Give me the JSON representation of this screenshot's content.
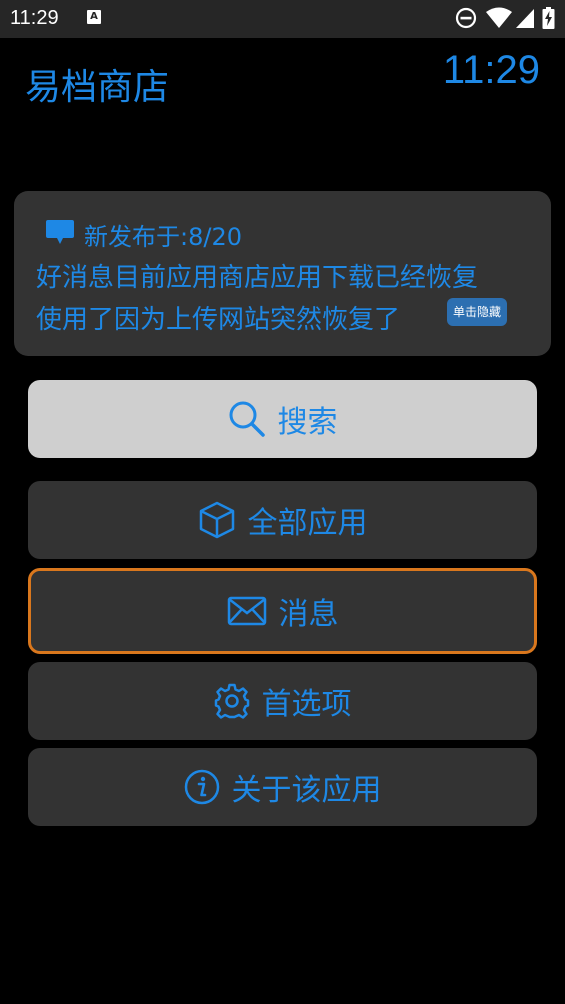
{
  "status_bar": {
    "time": "11:29",
    "a_badge": "A"
  },
  "header": {
    "title": "易档商店",
    "clock": "11:29"
  },
  "notice": {
    "date_line": "新发布于:8/20",
    "line1": "好消息目前应用商店应用下载已经恢复",
    "line2": "使用了因为上传网站突然恢复了",
    "hide_label": "单击隐藏"
  },
  "menu": {
    "search": "搜索",
    "all_apps": "全部应用",
    "messages": "消息",
    "preferences": "首选项",
    "about": "关于该应用"
  },
  "colors": {
    "accent": "#1e88e5",
    "focus_border": "#d9771d",
    "panel": "#333333",
    "search_bg": "#cfcfcf"
  }
}
